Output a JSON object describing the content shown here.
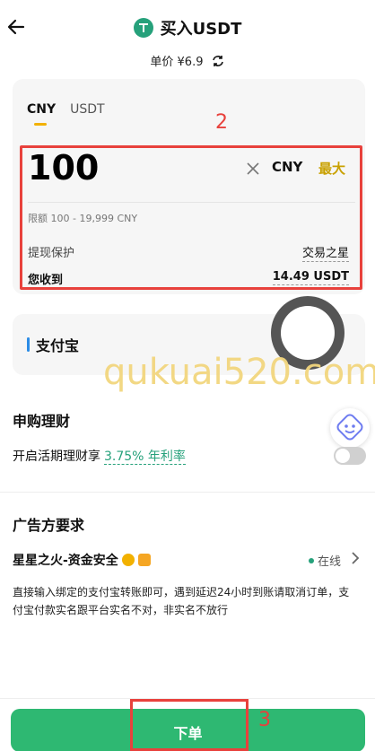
{
  "header": {
    "title": "买入USDT"
  },
  "price": {
    "label": "单价",
    "value": "¥6.9"
  },
  "tabs": [
    {
      "label": "CNY"
    },
    {
      "label": "USDT"
    }
  ],
  "amount": {
    "value": "100",
    "currency": "CNY",
    "max_label": "最大",
    "limit": "限额 100 - 19,999 CNY"
  },
  "withdraw": {
    "label": "提现保护",
    "value": "交易之星"
  },
  "receive": {
    "label": "您收到",
    "value": "14.49 USDT"
  },
  "annotations": {
    "box2": "2",
    "box3": "3"
  },
  "payment": {
    "method": "支付宝"
  },
  "watermark": "qukuai520.com",
  "finance": {
    "title": "申购理财",
    "row_label": "开启活期理财享",
    "rate": "3.75% 年利率"
  },
  "advertiser": {
    "title": "广告方要求",
    "name": "星星之火-资金安全",
    "status": "在线",
    "description": "直接输入绑定的支付宝转账即可，遇到延迟24小时到账请取消订单，支付宝付款实名跟平台实名不对，非实名不放行"
  },
  "footer": {
    "order_label": "下单"
  },
  "colors": {
    "accent": "#f2b100",
    "green": "#2eb872",
    "highlight": "#e8413c"
  }
}
